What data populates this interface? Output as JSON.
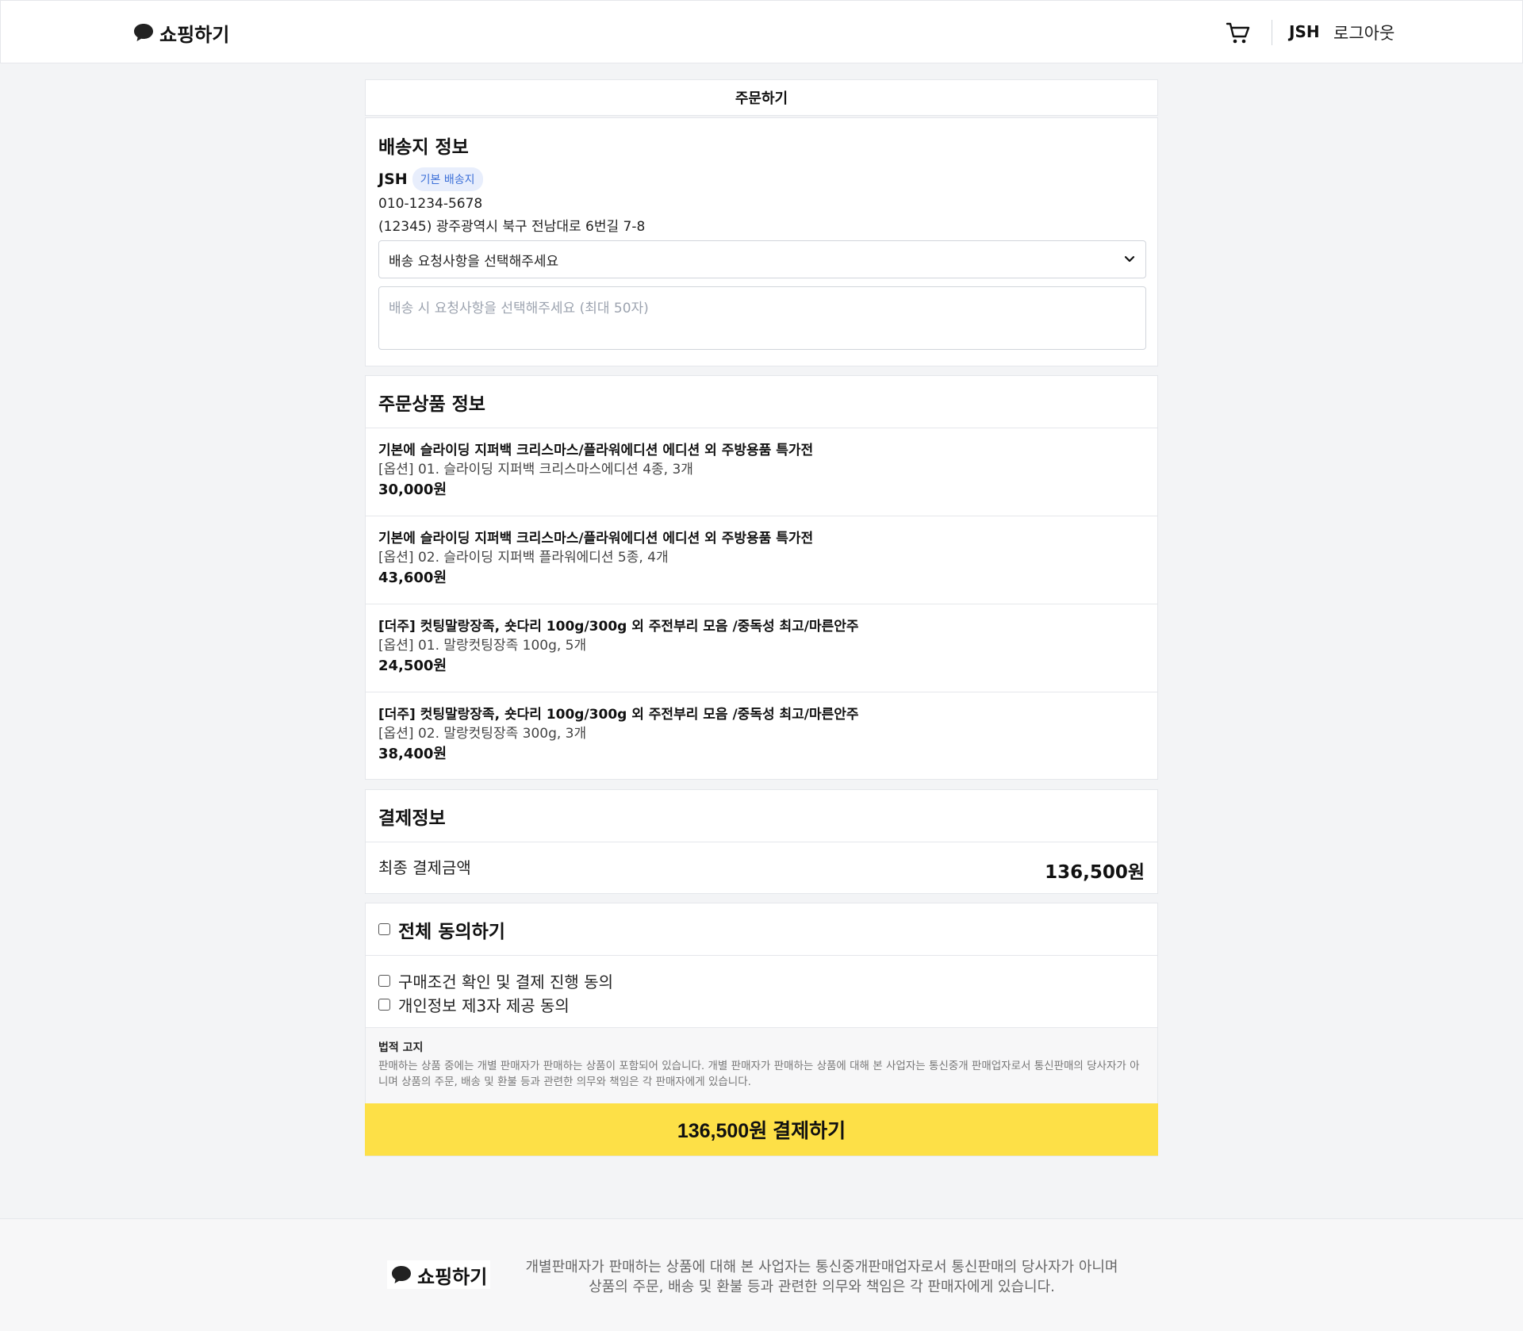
{
  "header": {
    "logo_text": "쇼핑하기",
    "logo_icon": "chat-bubble-icon",
    "cart_icon": "cart-icon",
    "user_name": "JSH",
    "logout_label": "로그아웃"
  },
  "page_title": "주문하기",
  "shipping": {
    "title": "배송지 정보",
    "name": "JSH",
    "badge": "기본 배송지",
    "phone": "010-1234-5678",
    "address": "(12345) 광주광역시 북구 전남대로 6번길 7-8",
    "request_select": "배송 요청사항을 선택해주세요",
    "request_placeholder": "배송 시 요청사항을 선택해주세요 (최대 50자)"
  },
  "products": {
    "title": "주문상품 정보",
    "items": [
      {
        "name": "기본에 슬라이딩 지퍼백 크리스마스/플라워에디션 에디션 외 주방용품 특가전",
        "option": "[옵션] 01. 슬라이딩 지퍼백 크리스마스에디션 4종, 3개",
        "price": "30,000원"
      },
      {
        "name": "기본에 슬라이딩 지퍼백 크리스마스/플라워에디션 에디션 외 주방용품 특가전",
        "option": "[옵션] 02. 슬라이딩 지퍼백 플라워에디션 5종, 4개",
        "price": "43,600원"
      },
      {
        "name": "[더주] 컷팅말랑장족, 숏다리 100g/300g 외 주전부리 모음 /중독성 최고/마른안주",
        "option": "[옵션] 01. 말랑컷팅장족 100g, 5개",
        "price": "24,500원"
      },
      {
        "name": "[더주] 컷팅말랑장족, 숏다리 100g/300g 외 주전부리 모음 /중독성 최고/마른안주",
        "option": "[옵션] 02. 말랑컷팅장족 300g, 3개",
        "price": "38,400원"
      }
    ]
  },
  "payment": {
    "title": "결제정보",
    "total_label": "최종 결제금액",
    "total_value": "136,500원"
  },
  "agreement": {
    "all_label": "전체 동의하기",
    "items": [
      "구매조건 확인 및 결제 진행 동의",
      "개인정보 제3자 제공 동의"
    ],
    "legal_title": "법적 고지",
    "legal_text": "판매하는 상품 중에는 개별 판매자가 판매하는 상품이 포함되어 있습니다. 개별 판매자가 판매하는 상품에 대해 본 사업자는 통신중개 판매업자로서 통신판매의 당사자가 아니며 상품의 주문, 배송 및 환불 등과 관련한 의무와 책임은 각 판매자에게 있습니다."
  },
  "pay_button": "136,500원 결제하기",
  "footer": {
    "logo_text": "쇼핑하기",
    "line1": "개별판매자가 판매하는 상품에 대해 본 사업자는 통신중개판매업자로서 통신판매의 당사자가 아니며",
    "line2": "상품의 주문, 배송 및 환불 등과 관련한 의무와 책임은 각 판매자에게 있습니다."
  }
}
